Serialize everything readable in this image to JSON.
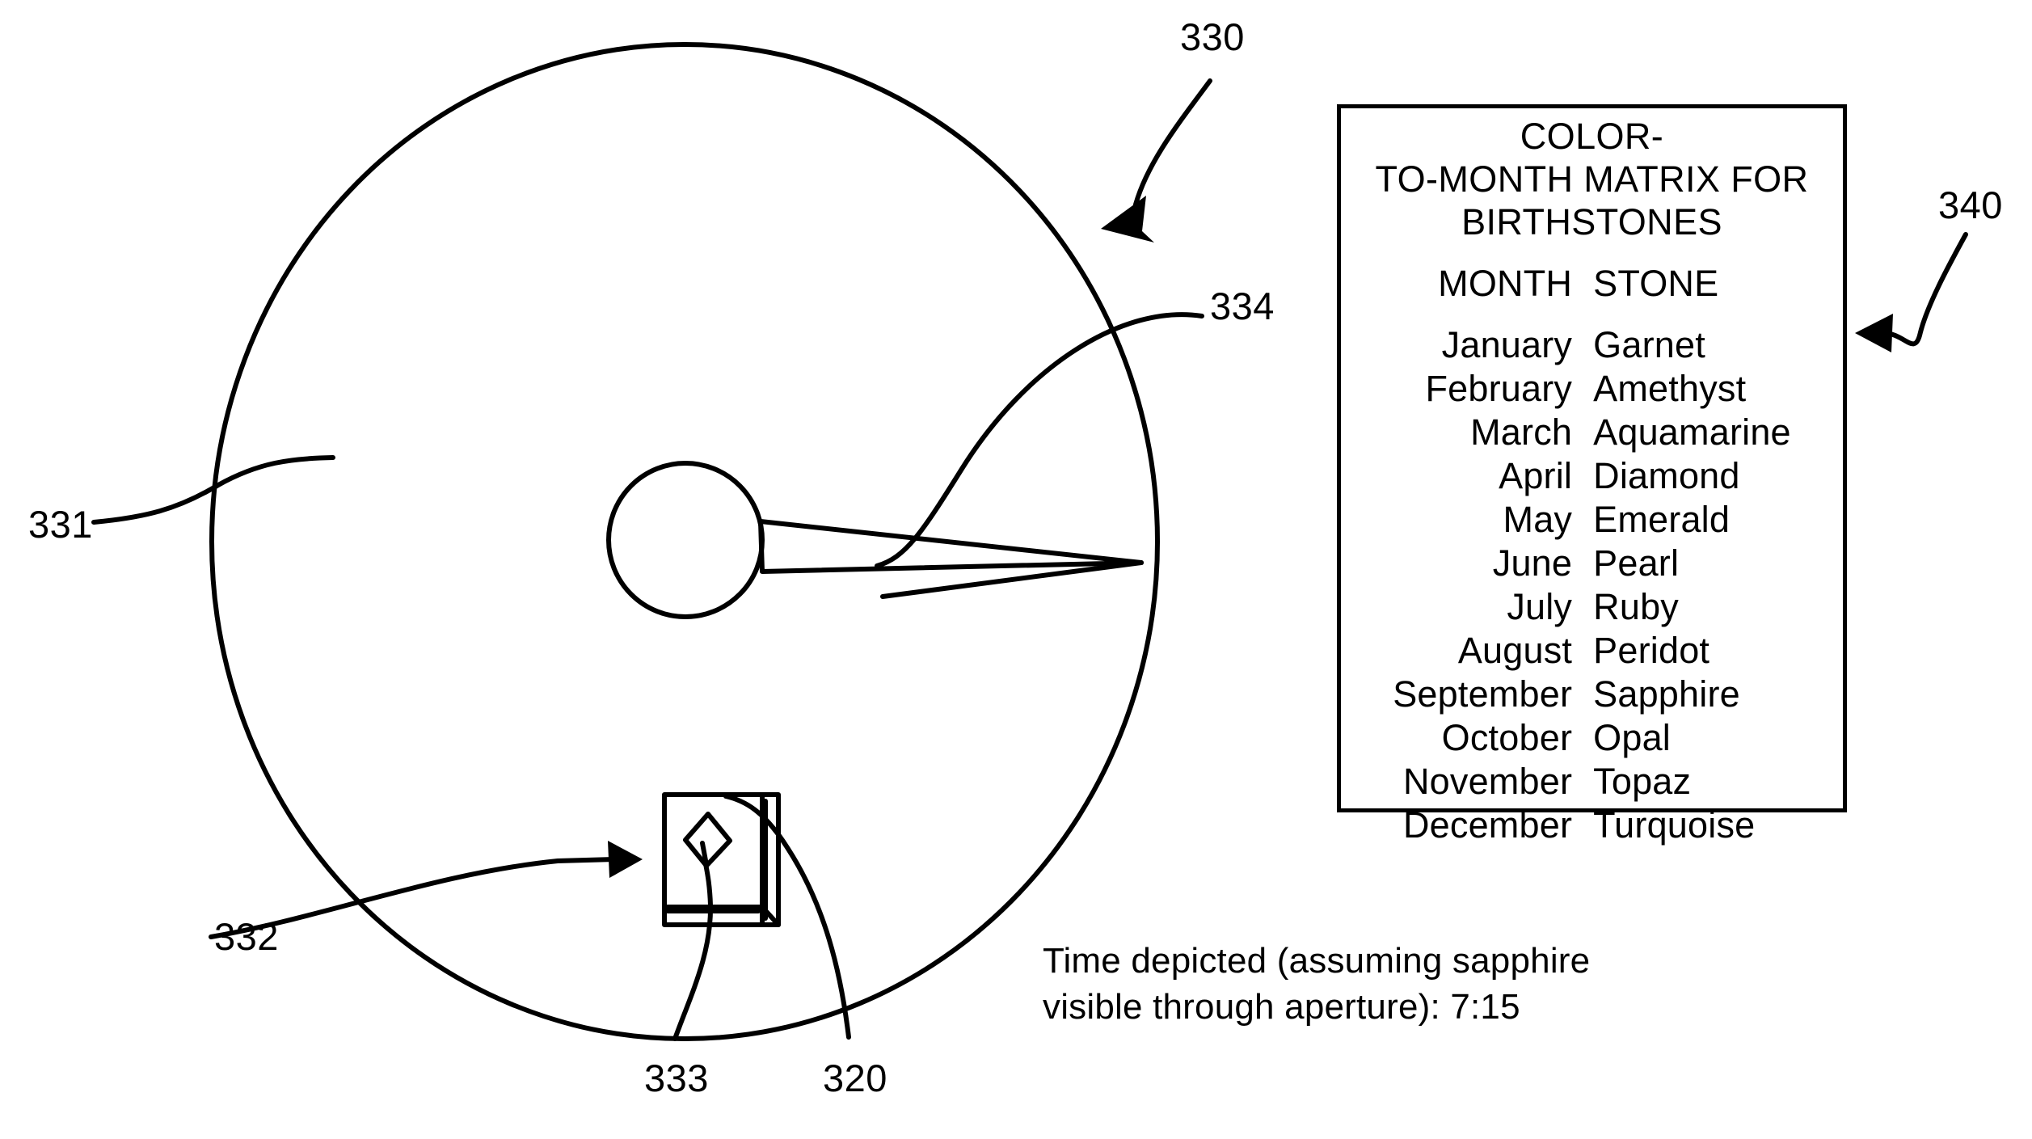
{
  "figure": {
    "kind": "patent-figure",
    "description": "Clock face with birthstone aperture and color-to-month matrix legend"
  },
  "reference_numerals": [
    {
      "id": "330",
      "label": "330",
      "target": "clock-face-outer-circle"
    },
    {
      "id": "334",
      "label": "334",
      "target": "clock-hand"
    },
    {
      "id": "331",
      "label": "331",
      "target": "clock-face-rim"
    },
    {
      "id": "332",
      "label": "332",
      "target": "aperture-window"
    },
    {
      "id": "333",
      "label": "333",
      "target": "gemstone"
    },
    {
      "id": "320",
      "label": "320",
      "target": "aperture-frame"
    },
    {
      "id": "340",
      "label": "340",
      "target": "matrix-legend-box"
    }
  ],
  "matrix": {
    "title": "COLOR-\nTO-MONTH MATRIX FOR\nBIRTHSTONES",
    "columns": [
      "MONTH",
      "STONE"
    ],
    "rows": [
      {
        "month": "January",
        "stone": "Garnet"
      },
      {
        "month": "February",
        "stone": "Amethyst"
      },
      {
        "month": "March",
        "stone": "Aquamarine"
      },
      {
        "month": "April",
        "stone": "Diamond"
      },
      {
        "month": "May",
        "stone": "Emerald"
      },
      {
        "month": "June",
        "stone": "Pearl"
      },
      {
        "month": "July",
        "stone": "Ruby"
      },
      {
        "month": "August",
        "stone": "Peridot"
      },
      {
        "month": "September",
        "stone": "Sapphire"
      },
      {
        "month": "October",
        "stone": "Opal"
      },
      {
        "month": "November",
        "stone": "Topaz"
      },
      {
        "month": "December",
        "stone": "Turquoise"
      }
    ]
  },
  "caption": {
    "text": "Time depicted (assuming sapphire\nvisible through aperture):  7:15"
  },
  "colors": {
    "ink": "#000000",
    "paper": "#ffffff"
  }
}
